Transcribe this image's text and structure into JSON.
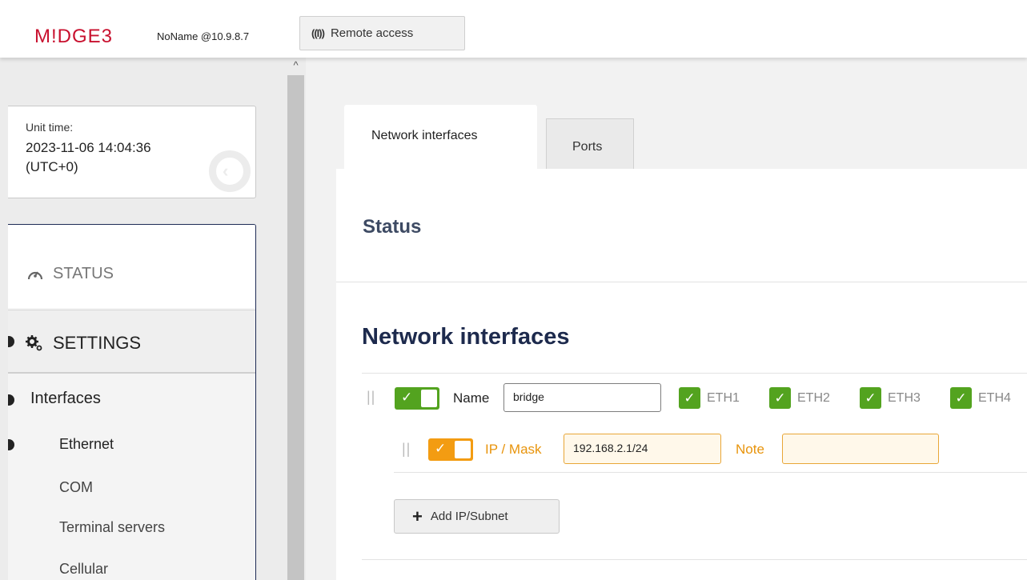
{
  "header": {
    "logo": "M!DGE3",
    "hostname": "NoName @10.9.8.7",
    "remote_icon": "((I))",
    "remote_label": "Remote access"
  },
  "sidebar": {
    "unit_time_label": "Unit time:",
    "unit_time_value": "2023-11-06 14:04:36 (UTC+0)",
    "status_label": "STATUS",
    "settings_label": "SETTINGS",
    "items": [
      {
        "label": "Interfaces"
      },
      {
        "label": "Ethernet"
      },
      {
        "label": "COM"
      },
      {
        "label": "Terminal servers"
      },
      {
        "label": "Cellular"
      }
    ]
  },
  "tabs": [
    {
      "label": "Network interfaces",
      "active": true
    },
    {
      "label": "Ports",
      "active": false
    }
  ],
  "main": {
    "status_title": "Status",
    "section_title": "Network interfaces",
    "interface": {
      "enabled": true,
      "name_label": "Name",
      "name_value": "bridge",
      "ports": [
        {
          "label": "ETH1",
          "checked": true
        },
        {
          "label": "ETH2",
          "checked": true
        },
        {
          "label": "ETH3",
          "checked": true
        },
        {
          "label": "ETH4",
          "checked": true
        }
      ],
      "ip_enabled": true,
      "ip_label": "IP / Mask",
      "ip_value": "192.168.2.1/24",
      "note_label": "Note",
      "note_value": ""
    },
    "add_button_label": "Add IP/Subnet"
  },
  "colors": {
    "brand": "#c8102e",
    "accent_green": "#53a31f",
    "accent_orange": "#f39c12",
    "heading": "#1d2a4d"
  }
}
